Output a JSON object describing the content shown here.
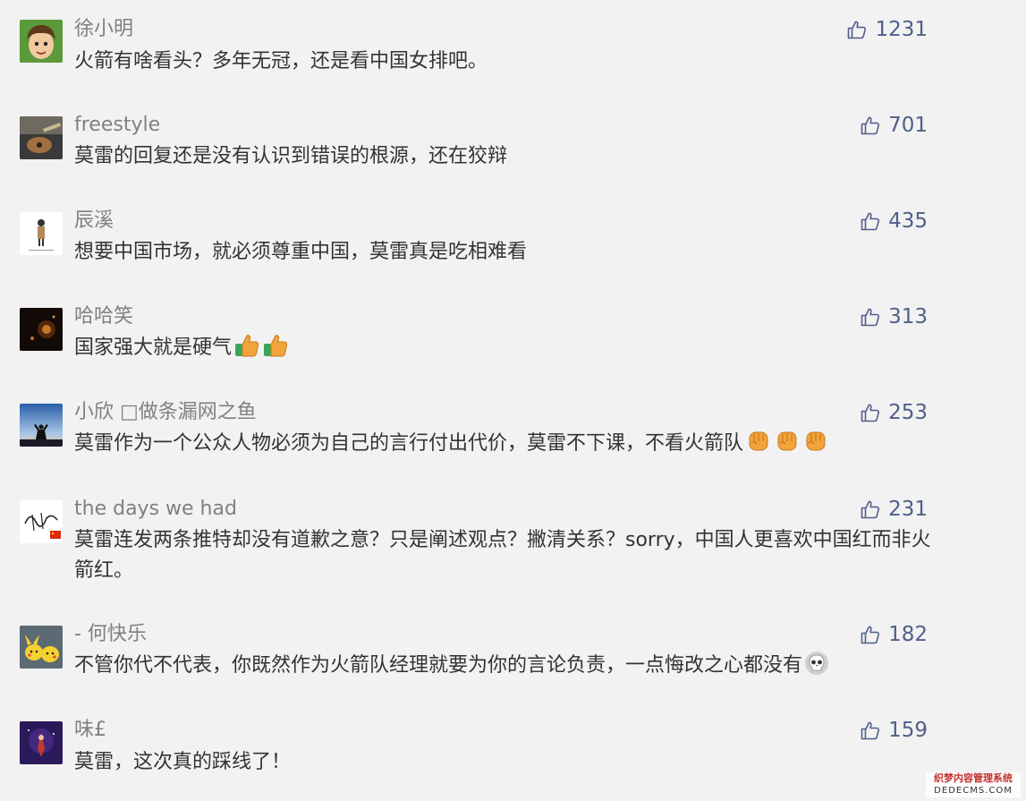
{
  "comments": [
    {
      "user": "徐小明",
      "text": "火箭有啥看头？多年无冠，还是看中国女排吧。",
      "likes": "1231",
      "avatar": "cartoon-boy-avatar"
    },
    {
      "user": "freestyle",
      "text": "莫雷的回复还是没有认识到错误的根源，还在狡辩",
      "likes": "701",
      "avatar": "guitar-photo-avatar"
    },
    {
      "user": "辰溪",
      "text": "想要中国市场，就必须尊重中国，莫雷真是吃相难看",
      "likes": "435",
      "avatar": "sketch-figure-avatar"
    },
    {
      "user": "哈哈笑",
      "text": "国家强大就是硬气",
      "likes": "313",
      "avatar": "night-fire-avatar"
    },
    {
      "user": "小欣 □做条漏网之鱼",
      "text": "莫雷作为一个公众人物必须为自己的言行付出代价，莫雷不下课，不看火箭队",
      "likes": "253",
      "avatar": "sunset-person-avatar"
    },
    {
      "user": "the days we had",
      "text": "莫雷连发两条推特却没有道歉之意？只是阐述观点？撇清关系？sorry，中国人更喜欢中国红而非火箭红。",
      "likes": "231",
      "avatar": "signature-flag-avatar"
    },
    {
      "user": "- 何快乐",
      "text": "不管你代不代表，你既然作为火箭队经理就要为你的言论负责，一点悔改之心都没有",
      "likes": "182",
      "avatar": "pikachu-avatar"
    },
    {
      "user": "味£",
      "text": "莫雷，这次真的踩线了！",
      "likes": "159",
      "avatar": "fantasy-art-avatar"
    }
  ],
  "watermark": {
    "line1": "织梦内容管理系统",
    "line2": "DEDECMS.COM"
  },
  "colors": {
    "background": "#f2f2f2",
    "username": "#808080",
    "text": "#333333",
    "like": "#4f5f8a"
  }
}
